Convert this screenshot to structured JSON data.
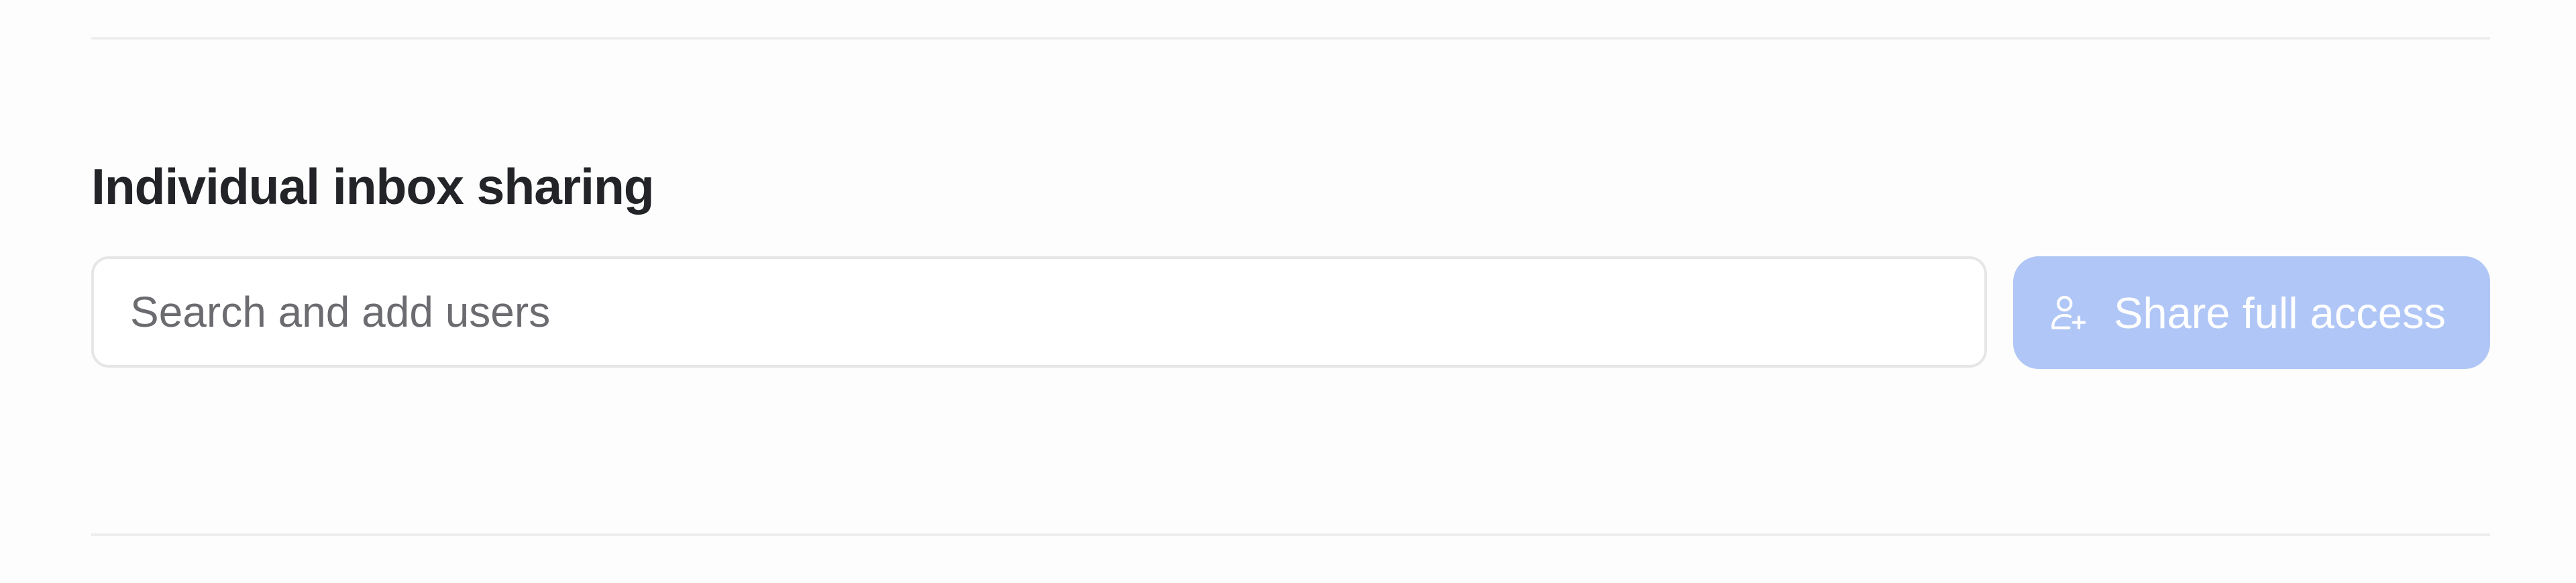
{
  "section": {
    "title": "Individual inbox sharing"
  },
  "search": {
    "placeholder": "Search and add users",
    "value": ""
  },
  "share_button": {
    "label": "Share full access",
    "icon": "user-plus-icon",
    "state": "disabled"
  },
  "colors": {
    "button_background": "#b0c6f6",
    "button_text": "#ffffff",
    "title_text": "#232428",
    "divider": "#eeeeee"
  }
}
